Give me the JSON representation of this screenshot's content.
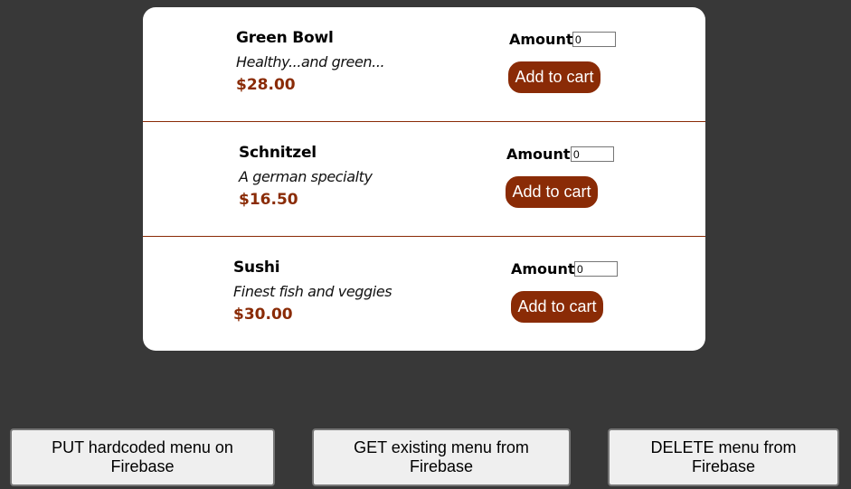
{
  "meals": [
    {
      "name": "Green Bowl",
      "description": "Healthy...and green...",
      "price": "$28.00",
      "amount_label": "Amount",
      "amount_value": "0",
      "add_label": "Add to cart"
    },
    {
      "name": "Schnitzel",
      "description": "A german specialty",
      "price": "$16.50",
      "amount_label": "Amount",
      "amount_value": "0",
      "add_label": "Add to cart"
    },
    {
      "name": "Sushi",
      "description": "Finest fish and veggies",
      "price": "$30.00",
      "amount_label": "Amount",
      "amount_value": "0",
      "add_label": "Add to cart"
    }
  ],
  "actions": {
    "put_label": "PUT hardcoded menu on Firebase",
    "get_label": "GET existing menu from Firebase",
    "delete_label": "DELETE menu from Firebase"
  },
  "colors": {
    "accent": "#8a2b06",
    "background": "#383838",
    "card": "#ffffff"
  }
}
